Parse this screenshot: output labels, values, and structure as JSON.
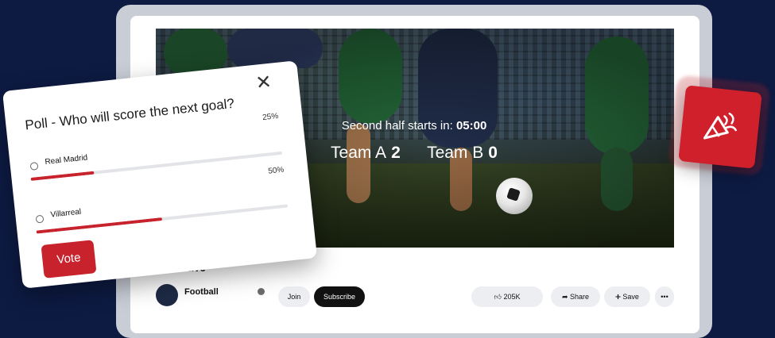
{
  "video": {
    "halftime_label": "Second half starts in:",
    "countdown": "05:00",
    "team_a": "Team A",
    "score_a": "2",
    "team_b": "Team B",
    "score_b": "0"
  },
  "below": {
    "title": "Port Live",
    "channel": "Football",
    "join_label": "Join",
    "subscribe_label": "Subscribe",
    "like_count": "205K",
    "share_label": "Share",
    "save_label": "Save",
    "more_label": "•••"
  },
  "poll": {
    "title": "Poll - Who will score the next goal?",
    "close_icon": "close-icon",
    "options": [
      {
        "label": "Real Madrid",
        "percent": "25%",
        "value": 0.25
      },
      {
        "label": "Villarreal",
        "percent": "50%",
        "value": 0.5
      }
    ],
    "vote_label": "Vote"
  },
  "badge": {
    "icon": "party-popper-icon",
    "color": "#d0202b"
  },
  "colors": {
    "accent": "#c8232c",
    "background": "#0d1a42"
  }
}
